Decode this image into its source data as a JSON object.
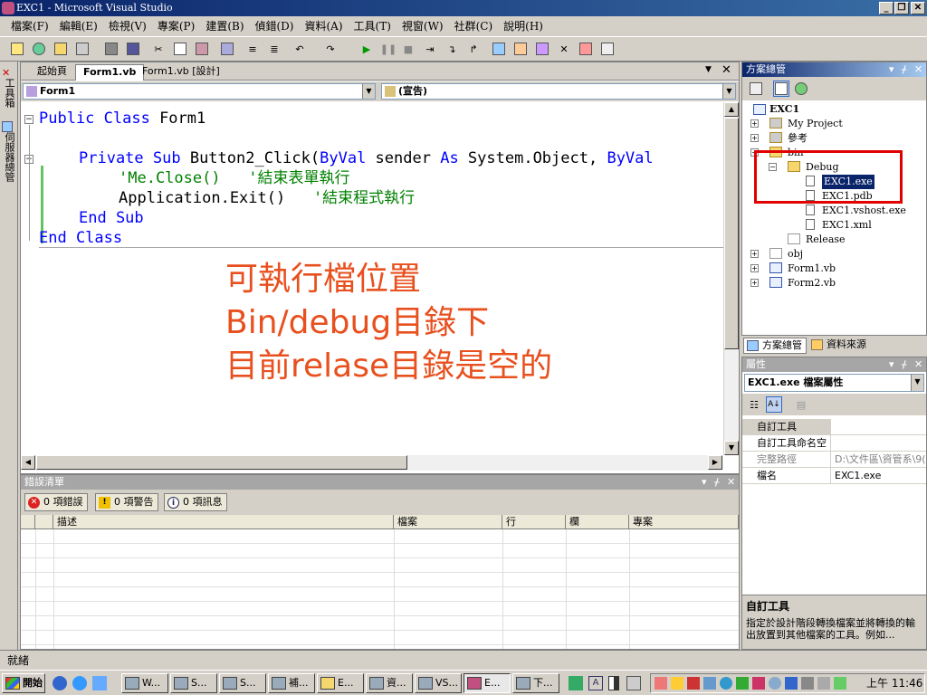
{
  "window": {
    "title": "EXC1 - Microsoft Visual Studio"
  },
  "menu": [
    "檔案(F)",
    "編輯(E)",
    "檢視(V)",
    "專案(P)",
    "建置(B)",
    "偵錯(D)",
    "資料(A)",
    "工具(T)",
    "視窗(W)",
    "社群(C)",
    "說明(H)"
  ],
  "left_tabs": {
    "toolbox": "工具箱",
    "server": "伺服器總管"
  },
  "doc_tabs": [
    "起始頁",
    "Form1.vb",
    "Form1.vb [設計]"
  ],
  "combos": {
    "left": "Form1",
    "right": "(宣告)"
  },
  "code": {
    "l1_kw": "Public Class",
    "l1_rest": " Form1",
    "l2_kw1": "Private Sub",
    "l2_mid": " Button2_Click(",
    "l2_kw2": "ByVal",
    "l2_mid2": " sender ",
    "l2_kw3": "As",
    "l2_mid3": " System.Object, ",
    "l2_kw4": "ByVal",
    "l3": "'Me.Close()   '結束表單執行",
    "l4_code": "Application.Exit()   ",
    "l4_cm": "'結束程式執行",
    "l5": "End Sub",
    "l6": "End Class"
  },
  "annotation": [
    "可執行檔位置",
    "Bin/debug目錄下",
    "目前relase目錄是空的"
  ],
  "error_list": {
    "title": "錯誤清單",
    "errors": "0 項錯誤",
    "warnings": "0 項警告",
    "messages": "0 項訊息",
    "columns": [
      "描述",
      "檔案",
      "行",
      "欄",
      "專案"
    ]
  },
  "solution": {
    "title": "方案總管",
    "project": "EXC1",
    "items": {
      "my_project": "My Project",
      "refs": "參考",
      "bin": "bin",
      "debug": "Debug",
      "exe": "EXC1.exe",
      "pdb": "EXC1.pdb",
      "vshost": "EXC1.vshost.exe",
      "xml": "EXC1.xml",
      "release": "Release",
      "obj": "obj",
      "form1": "Form1.vb",
      "form2": "Form2.vb"
    },
    "bottom_tabs": [
      "方案總管",
      "資料來源"
    ]
  },
  "properties": {
    "title": "屬性",
    "object": "EXC1.exe 檔案屬性",
    "rows": [
      {
        "name": "自訂工具",
        "value": ""
      },
      {
        "name": "自訂工具命名空",
        "value": ""
      },
      {
        "name": "完整路徑",
        "value": "D:\\文件區\\資管系\\9("
      },
      {
        "name": "檔名",
        "value": "EXC1.exe"
      }
    ],
    "desc_title": "自訂工具",
    "desc_text": "指定於設計階段轉換檔案並將轉換的輸出放置到其他檔案的工具。例如..."
  },
  "status": "就緒",
  "taskbar": {
    "start": "開始",
    "buttons": [
      "W...",
      "S...",
      "S...",
      "補...",
      "E...",
      "資...",
      "VS...",
      "E...",
      "下..."
    ],
    "clock": "上午 11:46"
  }
}
